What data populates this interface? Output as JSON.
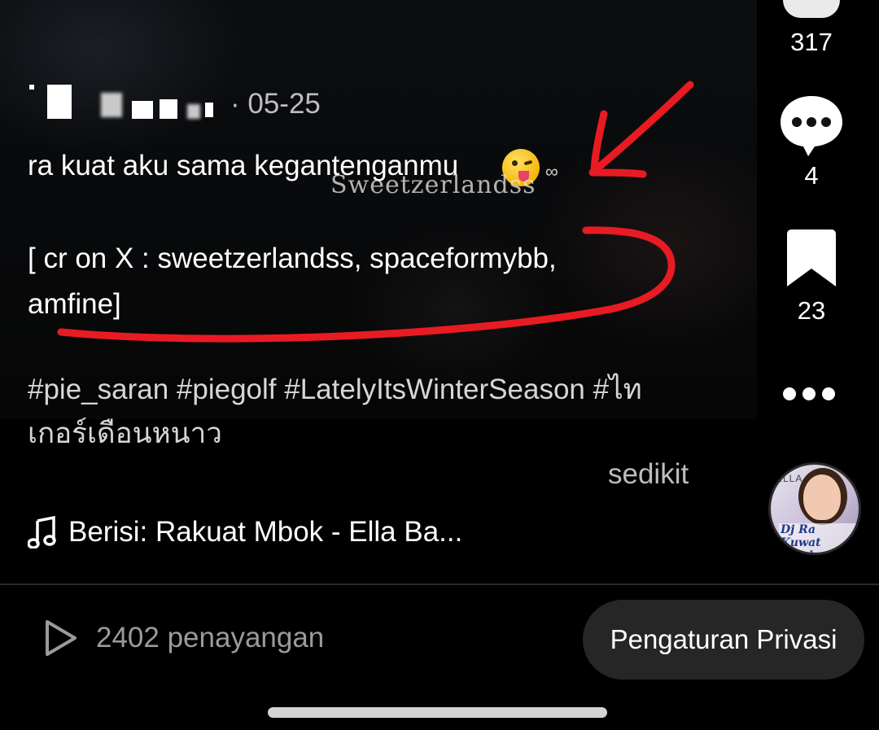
{
  "post": {
    "date": "· 05-25",
    "caption": "ra kuat aku sama kegantenganmu",
    "caption_infinity": "∞",
    "watermark": "Sweetzerlandss",
    "credit": "[ cr on X : sweetzerlandss, spaceformybb, amfine]",
    "hashtags": "#pie_saran #piegolf #LatelyItsWinterSeason #ไทเกอร์เดือนหนาว",
    "translate_hint": "sedikit",
    "music": "Berisi: Rakuat Mbok - Ella Ba..."
  },
  "sidebar": {
    "likes_count": "317",
    "comments_count": "4",
    "bookmarks_count": "23"
  },
  "disc": {
    "brand": "ELLA",
    "label": "Dj Ra Kuwat Mbok"
  },
  "footer": {
    "views": "2402 penayangan",
    "privacy_button": "Pengaturan Privasi"
  },
  "icons": {
    "music": "music-note-icon",
    "play": "play-icon",
    "comment": "comment-bubble-icon",
    "bookmark": "bookmark-icon",
    "more": "more-dots-icon",
    "like": "heart-icon"
  },
  "colors": {
    "background": "#000000",
    "annotation_red": "#e81b23",
    "muted_text": "#bdbdbd",
    "button_bg": "#262626"
  }
}
